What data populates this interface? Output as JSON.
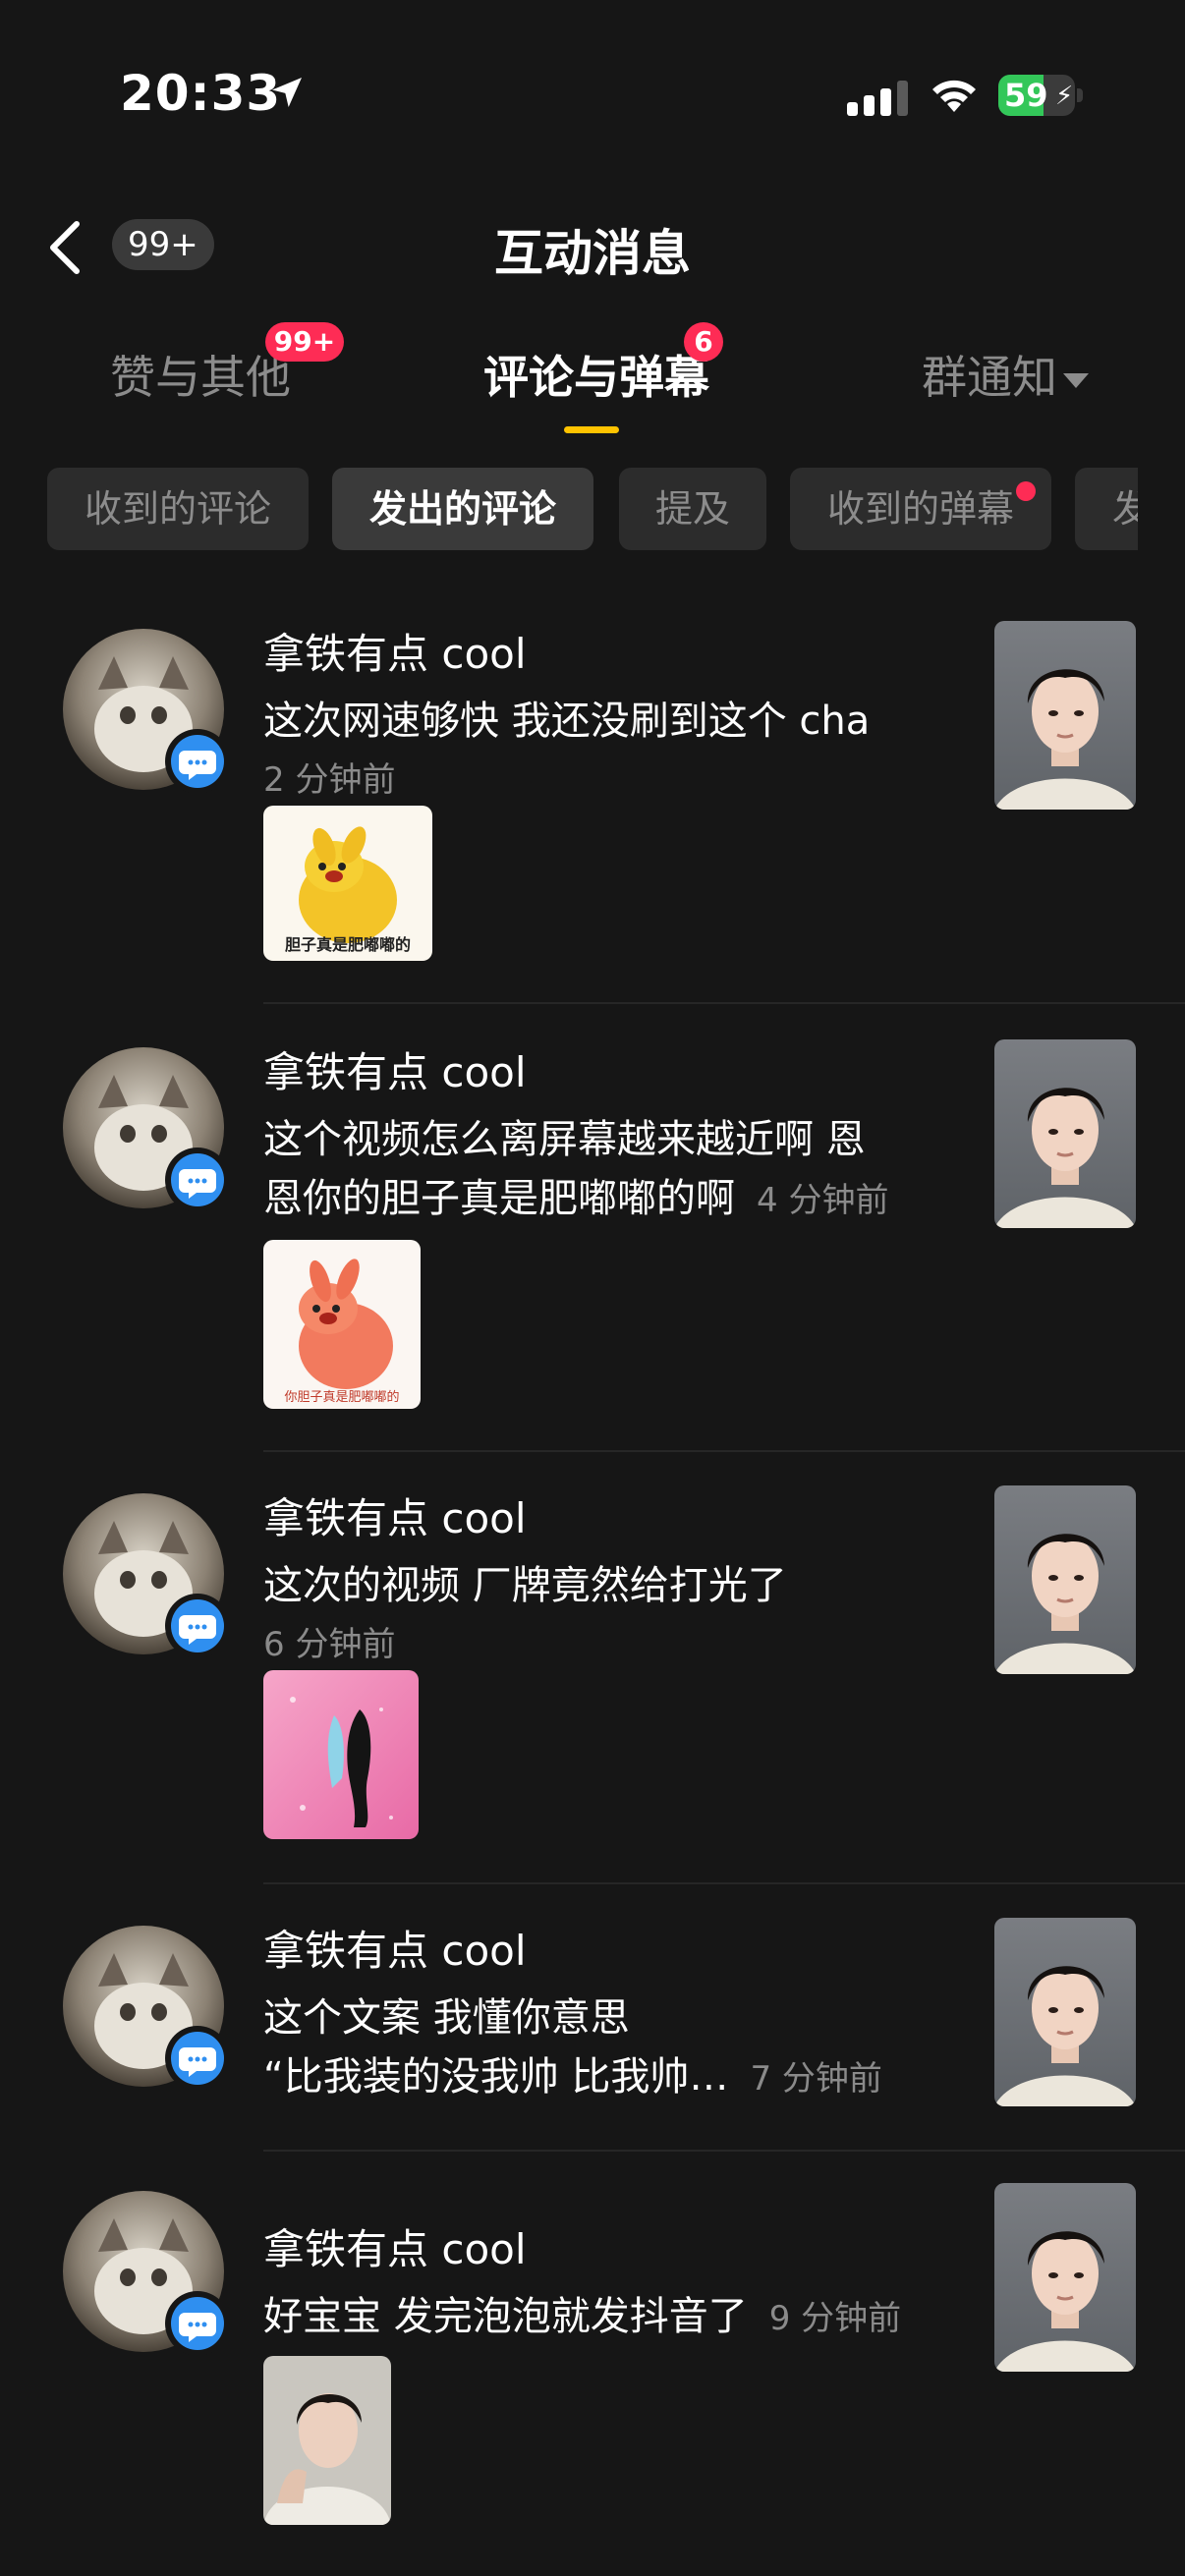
{
  "status_bar": {
    "time": "20:33",
    "battery": "59",
    "battery_level": 0.59
  },
  "header": {
    "title": "互动消息",
    "back_badge": "99+"
  },
  "tabs": [
    {
      "label": "赞与其他",
      "badge": "99+"
    },
    {
      "label": "评论与弹幕",
      "badge": "6"
    },
    {
      "label": "群通知"
    }
  ],
  "filters": [
    {
      "label": "收到的评论"
    },
    {
      "label": "发出的评论"
    },
    {
      "label": "提及"
    },
    {
      "label": "收到的弹幕"
    },
    {
      "label": "发"
    }
  ],
  "items": [
    {
      "name": "拿铁有点 cool",
      "text": "这次网速够快 我还没刷到这个 cha",
      "time": "2 分钟前",
      "sticker_caption": "胆子真是肥嘟嘟的"
    },
    {
      "name": "拿铁有点 cool",
      "text_line1": "这个视频怎么离屏幕越来越近啊 恩",
      "text_line2": "恩你的胆子真是肥嘟嘟的啊",
      "time": "4 分钟前",
      "sticker_caption": "你胆子真是肥嘟嘟的"
    },
    {
      "name": "拿铁有点 cool",
      "text": "这次的视频 厂牌竟然给打光了",
      "time": "6 分钟前"
    },
    {
      "name": "拿铁有点 cool",
      "text_line1": "这个文案 我懂你意思",
      "text_line2": "“比我装的没我帅 比我帅…",
      "time": "7 分钟前"
    },
    {
      "name": "拿铁有点 cool",
      "text": "好宝宝 发完泡泡就发抖音了",
      "time": "9 分钟前"
    }
  ],
  "colors": {
    "accent": "#ffc300",
    "badge": "#fe2c55",
    "message_icon": "#2f8ff0",
    "background": "#161616"
  },
  "icons": [
    "location-arrow-icon",
    "signal-icon",
    "wifi-icon",
    "battery-icon",
    "back-chevron-icon",
    "caret-down-icon",
    "message-bubble-icon"
  ]
}
